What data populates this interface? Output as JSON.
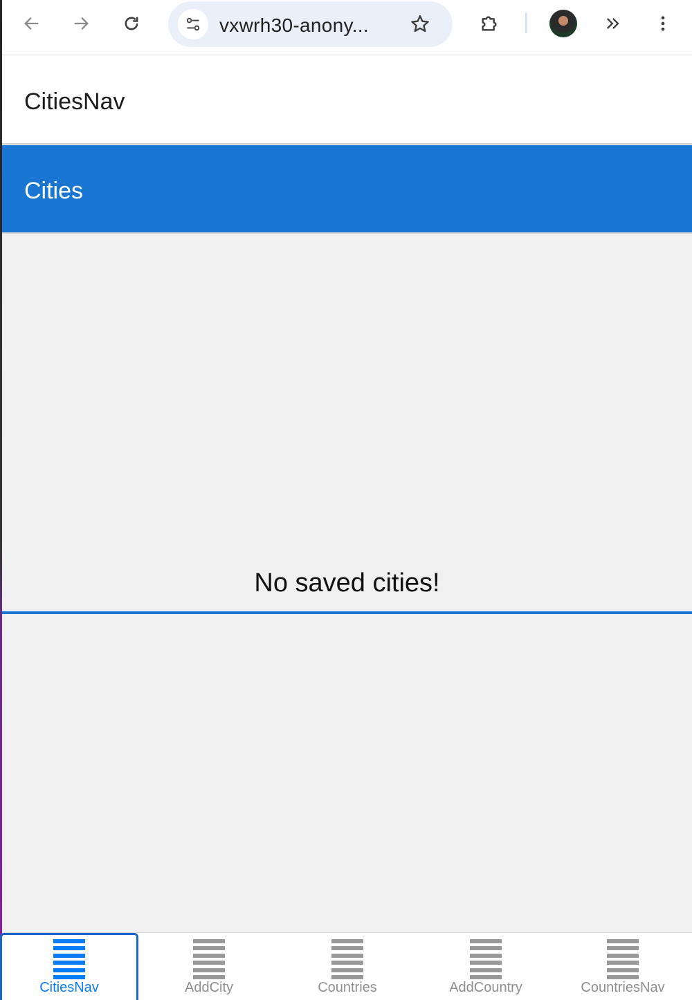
{
  "browser": {
    "url_text": "vxwrh30-anony...",
    "icons": {
      "back": "back-arrow-icon",
      "forward": "forward-arrow-icon",
      "reload": "reload-icon",
      "site_info": "tune-icon",
      "bookmark": "star-icon",
      "extensions": "puzzle-icon",
      "profile": "avatar",
      "overflow": "chevron-double-right-icon",
      "menu": "kebab-menu-icon"
    }
  },
  "app": {
    "nav_title": "CitiesNav",
    "screen_title": "Cities",
    "empty_message": "No saved cities!"
  },
  "tabs": [
    {
      "label": "CitiesNav",
      "active": true
    },
    {
      "label": "AddCity",
      "active": false
    },
    {
      "label": "Countries",
      "active": false
    },
    {
      "label": "AddCountry",
      "active": false
    },
    {
      "label": "CountriesNav",
      "active": false
    }
  ],
  "colors": {
    "primary": "#1976d2",
    "tab_active": "#0a7cf6",
    "tab_inactive": "#999999",
    "content_bg": "#f0f0f0"
  }
}
